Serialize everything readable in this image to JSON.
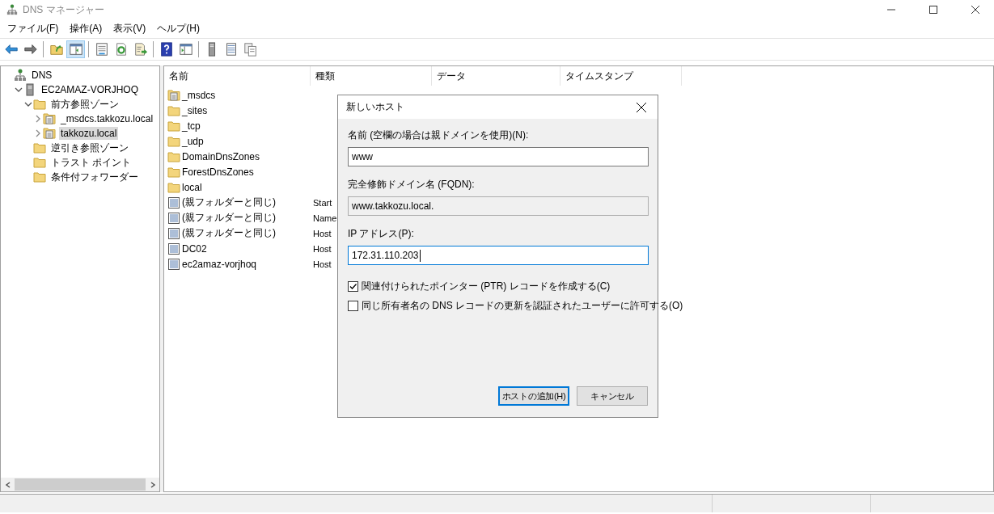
{
  "window": {
    "title": "DNS マネージャー"
  },
  "menu": [
    "ファイル(F)",
    "操作(A)",
    "表示(V)",
    "ヘルプ(H)"
  ],
  "toolbar": [
    {
      "kind": "back",
      "pressed": false
    },
    {
      "kind": "forward",
      "pressed": false
    },
    {
      "kind": "separator"
    },
    {
      "kind": "up",
      "pressed": false
    },
    {
      "kind": "tree-toggle",
      "pressed": true
    },
    {
      "kind": "separator"
    },
    {
      "kind": "properties",
      "pressed": false
    },
    {
      "kind": "refresh",
      "pressed": false
    },
    {
      "kind": "export",
      "pressed": false
    },
    {
      "kind": "separator"
    },
    {
      "kind": "help",
      "pressed": false
    },
    {
      "kind": "console",
      "pressed": false
    },
    {
      "kind": "separator"
    },
    {
      "kind": "server",
      "pressed": false
    },
    {
      "kind": "list",
      "pressed": false
    },
    {
      "kind": "copy",
      "pressed": false
    }
  ],
  "tree": [
    {
      "label": "DNS",
      "kind": "dns",
      "selected": false,
      "children": [
        {
          "label": "EC2AMAZ-VORJHOQ",
          "kind": "server",
          "expanded": true,
          "selected": false,
          "children": [
            {
              "label": "前方参照ゾーン",
              "kind": "folder",
              "expanded": true,
              "selected": false,
              "children": [
                {
                  "label": "_msdcs.takkozu.local",
                  "kind": "zone",
                  "expanded": false,
                  "selected": false
                },
                {
                  "label": "takkozu.local",
                  "kind": "zone",
                  "expanded": false,
                  "selected": true
                }
              ]
            },
            {
              "label": "逆引き参照ゾーン",
              "kind": "folder",
              "selected": false
            },
            {
              "label": "トラスト ポイント",
              "kind": "folder",
              "selected": false
            },
            {
              "label": "条件付フォワーダー",
              "kind": "folder",
              "selected": false
            }
          ]
        }
      ]
    }
  ],
  "table": {
    "columns": [
      "名前",
      "種類",
      "データ",
      "タイムスタンプ"
    ],
    "rows": [
      {
        "name": "_msdcs",
        "kind": "zone"
      },
      {
        "name": "_sites",
        "kind": "folder"
      },
      {
        "name": "_tcp",
        "kind": "folder"
      },
      {
        "name": "_udp",
        "kind": "folder"
      },
      {
        "name": "DomainDnsZones",
        "kind": "folder"
      },
      {
        "name": "ForestDnsZones",
        "kind": "folder"
      },
      {
        "name": "local",
        "kind": "folder"
      },
      {
        "name": "(親フォルダーと同じ)",
        "kind": "record",
        "type": "Start"
      },
      {
        "name": "(親フォルダーと同じ)",
        "kind": "record",
        "type": "Name"
      },
      {
        "name": "(親フォルダーと同じ)",
        "kind": "record",
        "type": "Host"
      },
      {
        "name": "DC02",
        "kind": "record",
        "type": "Host"
      },
      {
        "name": "ec2amaz-vorjhoq",
        "kind": "record",
        "type": "Host"
      }
    ]
  },
  "dialog": {
    "title": "新しいホスト",
    "fields": [
      {
        "label": "名前 (空欄の場合は親ドメインを使用)(N):",
        "value": "www",
        "kind": "input",
        "focused": false
      },
      {
        "label": "完全修飾ドメイン名 (FQDN):",
        "value": "www.takkozu.local.",
        "kind": "readonly",
        "focused": false
      },
      {
        "label": "IP アドレス(P):",
        "value": "172.31.110.203",
        "kind": "input",
        "focused": true
      }
    ],
    "checkboxes": [
      {
        "label": "関連付けられたポインター (PTR) レコードを作成する(C)",
        "checked": true
      },
      {
        "label": "同じ所有者名の DNS レコードの更新を認証されたユーザーに許可する(O)",
        "checked": false
      }
    ],
    "buttons": [
      {
        "label": "ホストの追加(H)",
        "default": true
      },
      {
        "label": "キャンセル",
        "default": false
      }
    ]
  }
}
